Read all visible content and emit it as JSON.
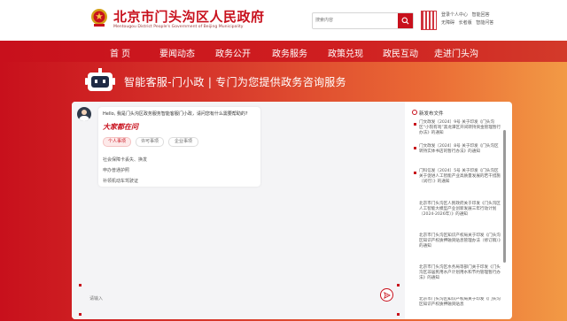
{
  "header": {
    "title": "北京市门头沟区人民政府",
    "subtitle": "Mentougou District People's Government of Beijing Municipality",
    "search_placeholder": "搜索内容",
    "user_links_row1": [
      "登录个人中心",
      "智能回答"
    ],
    "user_links_row2": [
      "无障碍",
      "长者版",
      "智能问答"
    ]
  },
  "nav": {
    "items": [
      "首 页",
      "要闻动态",
      "政务公开",
      "政务服务",
      "政策兑现",
      "政民互动",
      "走进门头沟"
    ]
  },
  "banner": {
    "text": "智能客服-门小政 | 专门为您提供政务咨询服务"
  },
  "chat": {
    "greeting": "Hello, 我是门头沟区政务服务智能客服门小政，请问您有什么需要帮助的?",
    "slogan": "大家都在问",
    "tabs": [
      "个人事项",
      "许可事项",
      "企业事项"
    ],
    "active_tab": "个人事项",
    "questions": [
      "社会保障卡丢失、换发",
      "申办普通护照",
      "补领机动车驾驶证"
    ],
    "input_placeholder": "请输入"
  },
  "news": {
    "title": "新发布文件",
    "items": [
      "门文政发〔2024〕9号 关于印发《门头沟区“小院有戏”黑龙潭区开间转持资金管理暂行办法》的通知",
      "门文政发〔2024〕8号 关于印发《门头沟区转持实体书店的暂行办法》的通知",
      "门科信发〔2024〕5号 关于印发《门头沟区关于促进人工智能产业高质量发展的若干措施（试行）》的通知",
      "北京市门头沟区人民政府关于印发《门头沟区人工智能大模型产业创新发展三年行动计划（2024-2026年）》的通知",
      "北京市门头沟区知识产权局关于印发《门头沟区知识产权质押融资贴息管理办法（修订稿）》的通知",
      "北京市门头沟区水务局等部门关于印发《门头沟区非居民用水户计划用水和节约管理暂行办法》的通知",
      "北京市门头沟区知识产权局关于印发《门头沟区知识产权质押融资贴息"
    ]
  },
  "colors": {
    "brand_red": "#c8101c",
    "orange": "#f29a45"
  }
}
